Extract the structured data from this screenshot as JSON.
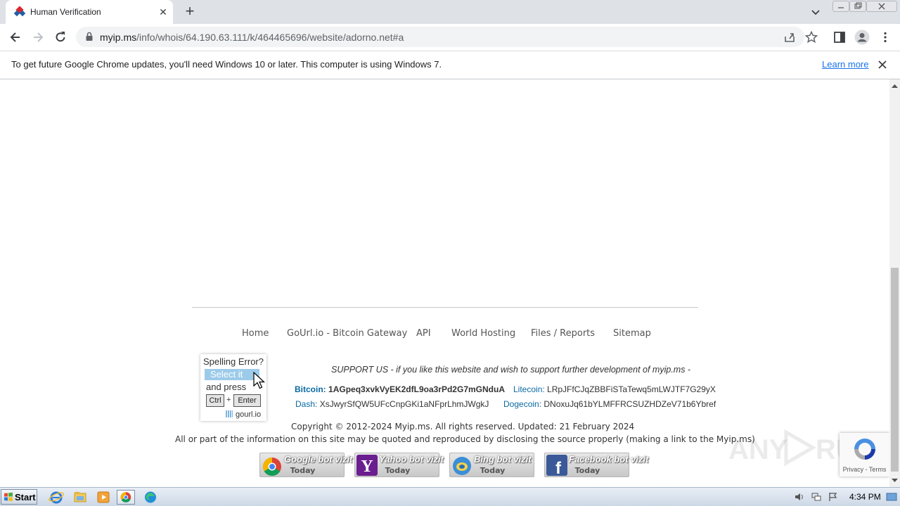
{
  "browser": {
    "tab_title": "Human Verification",
    "url_host": "myip.ms",
    "url_path": "/info/whois/64.190.63.111/k/464465696/website/adorno.net#a"
  },
  "infobar": {
    "message": "To get future Google Chrome updates, you'll need Windows 10 or later. This computer is using Windows 7.",
    "link": "Learn more"
  },
  "footer": {
    "nav": [
      "Home",
      "GoUrl.io - Bitcoin Gateway",
      "API",
      "World Hosting",
      "Files / Reports",
      "Sitemap"
    ],
    "support": "SUPPORT US - if you like this website and wish to support further development of myip.ms -",
    "crypto": {
      "bitcoin_label": "Bitcoin:",
      "bitcoin_addr": "1AGpeq3xvkVyEK2dfL9oa3rPd2G7mGNduA",
      "litecoin_label": "Litecoin:",
      "litecoin_addr": "LRpJFfCJqZBBFiSTaTewq5mLWJTF7G29yX",
      "dash_label": "Dash:",
      "dash_addr": "XsJwyrSfQW5UFcCnpGKi1aNFprLhmJWgkJ",
      "dogecoin_label": "Dogecoin:",
      "dogecoin_addr": "DNoxuJq61bYLMFFRCSUZHDZeV71b6Ybref"
    },
    "copyright": "Copyright © 2012-2024 Myip.ms. All rights reserved. Updated: 21 February 2024",
    "disclaimer": "All or part of the information on this site may be quoted and reproduced by disclosing the source properly (making a link to the Myip.ms)",
    "badges": [
      {
        "name": "Google bot vizit",
        "day": "Today"
      },
      {
        "name": "Yahoo bot vizit",
        "day": "Today"
      },
      {
        "name": "Bing bot vizit",
        "day": "Today"
      },
      {
        "name": "Facebook bot vizit",
        "day": "Today"
      }
    ]
  },
  "spelling_widget": {
    "title": "Spelling Error?",
    "select": "Select it",
    "and_press": "and press",
    "key_ctrl": "Ctrl",
    "plus": "+",
    "key_enter": "Enter",
    "brand": "gourl.io"
  },
  "recaptcha": {
    "links": "Privacy - Terms"
  },
  "taskbar": {
    "start": "Start",
    "time": "4:34 PM"
  }
}
